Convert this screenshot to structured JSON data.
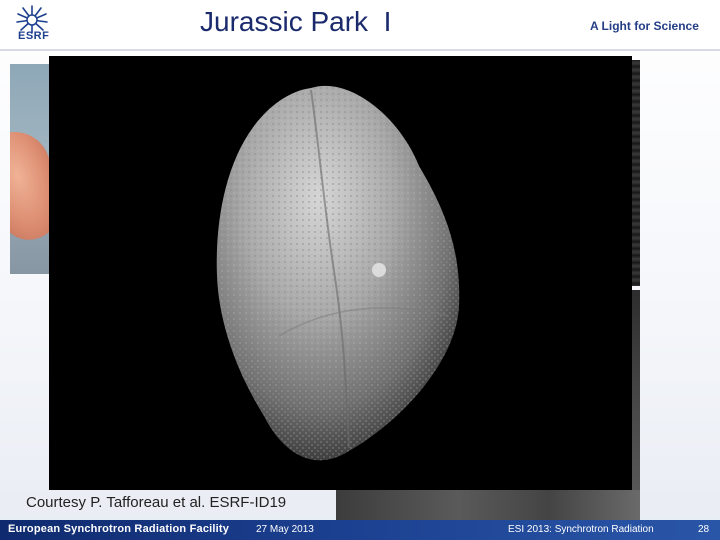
{
  "header": {
    "logo_text": "ESRF",
    "title": "Jurassic Park  I",
    "tagline": "A Light for Science"
  },
  "figure": {
    "caption": "Courtesy P. Tafforeau et al. ESRF-ID19"
  },
  "footer": {
    "organization": "European Synchrotron Radiation Facility",
    "date": "27 May 2013",
    "event": "ESI 2013: Synchrotron Radiation",
    "page_number": "28"
  },
  "colors": {
    "brand_blue": "#1d3f8f",
    "title_color": "#1a2a6c",
    "footer_bar": "#1b3f8f"
  }
}
